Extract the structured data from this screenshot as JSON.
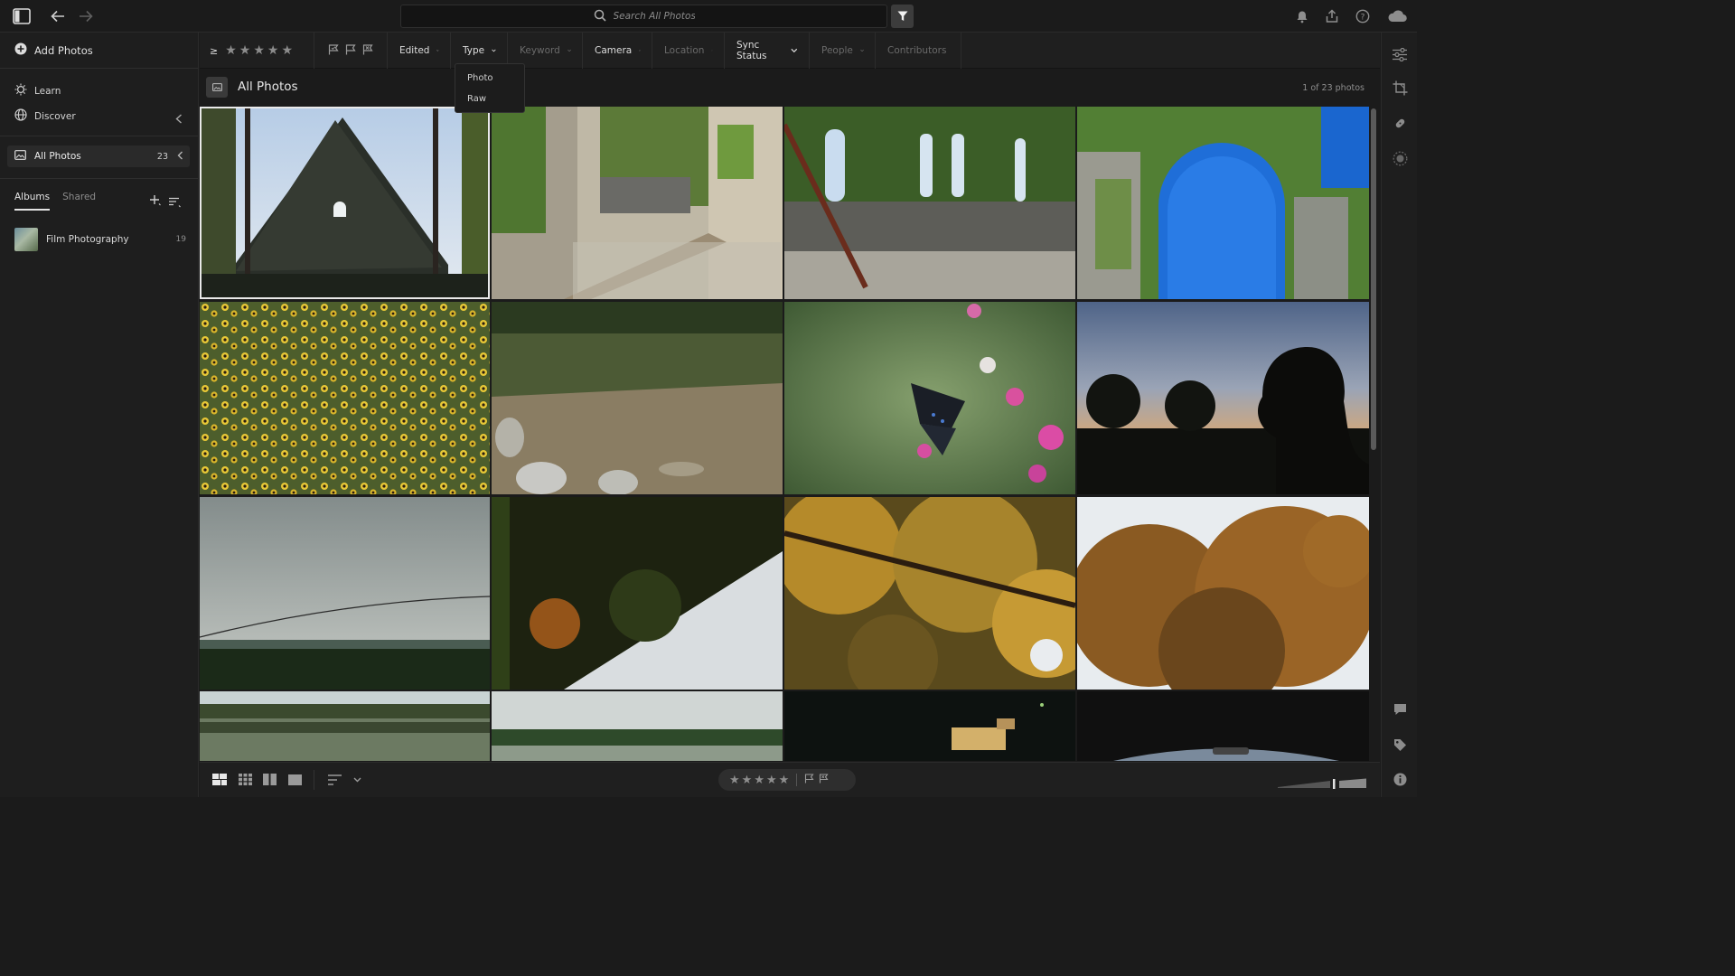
{
  "search": {
    "placeholder": "Search All Photos"
  },
  "left_panel": {
    "add_photos_label": "Add Photos",
    "nav": [
      {
        "label": "Learn",
        "icon": "bulb-icon"
      },
      {
        "label": "Discover",
        "icon": "globe-icon"
      }
    ],
    "all_photos": {
      "label": "All Photos",
      "count": "23"
    },
    "tabs": [
      {
        "label": "Albums",
        "active": true
      },
      {
        "label": "Shared",
        "active": false
      }
    ],
    "albums": [
      {
        "name": "Film Photography",
        "count": "19"
      }
    ]
  },
  "filter_bar": {
    "rating_operator": "≥",
    "segments": [
      {
        "label": "Edited",
        "enabled": true
      },
      {
        "label": "Type",
        "enabled": true,
        "open": true
      },
      {
        "label": "Keyword",
        "enabled": false
      },
      {
        "label": "Camera",
        "enabled": true
      },
      {
        "label": "Location",
        "enabled": false
      },
      {
        "label": "Sync Status",
        "enabled": true
      },
      {
        "label": "People",
        "enabled": false
      },
      {
        "label": "Contributors",
        "enabled": false
      }
    ],
    "type_dropdown_options": [
      "Photo",
      "Raw"
    ]
  },
  "grid_header": {
    "title": "All Photos",
    "count_text": "1 of 23 photos"
  },
  "photos": [
    "church gable silhouette against sky",
    "ivy-covered stone ruin with wooden rail",
    "ivy-covered ruin windows with graffiti",
    "ivy-covered stone arch with blue sky",
    "field of black-eyed susans",
    "shaded creek with rocks",
    "butterfly on pink wildflower",
    "man silhouette at sunset",
    "overcast sky over treeline",
    "autumn tree canopy sideways",
    "autumn maple leaves",
    "autumn tree against sky",
    "lake with reflection",
    "lake with treeline",
    "night scene lights",
    "car interior dashboard"
  ],
  "bottom_bar": {
    "view_modes": [
      "photo-grid-icon",
      "square-grid-icon",
      "detail-icon",
      "single-icon"
    ]
  },
  "colors": {
    "background": "#1b1b1b",
    "panel": "#1e1e1e",
    "accent": "#e9e9e9"
  }
}
